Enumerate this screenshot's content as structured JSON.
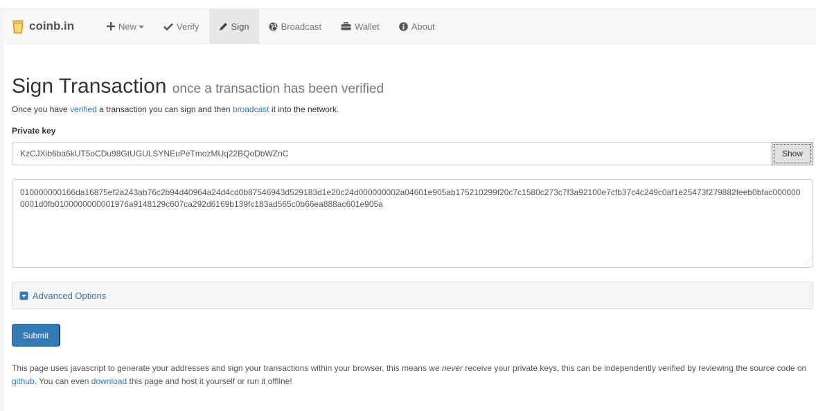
{
  "brand": {
    "name": "coinb.in"
  },
  "nav": {
    "items": [
      {
        "label": "New",
        "icon": "plus-icon",
        "dropdown": true
      },
      {
        "label": "Verify",
        "icon": "check-icon"
      },
      {
        "label": "Sign",
        "icon": "pencil-icon",
        "active": true
      },
      {
        "label": "Broadcast",
        "icon": "globe-icon"
      },
      {
        "label": "Wallet",
        "icon": "briefcase-icon"
      },
      {
        "label": "About",
        "icon": "info-icon"
      }
    ]
  },
  "page": {
    "title": "Sign Transaction",
    "subtitle": "once a transaction has been verified",
    "intro_before": "Once you have ",
    "intro_link1": "verified",
    "intro_middle": " a transaction you can sign and then ",
    "intro_link2": "broadcast",
    "intro_after": " it into the network."
  },
  "form": {
    "private_key_label": "Private key",
    "private_key_value": "KzCJXib6ba6kUT5oCDu98GtUGULSYNEuPeTmozMUq22BQoDbWZnC",
    "show_label": "Show",
    "transaction_hex": "010000000166da16875ef2a243ab76c2b94d40964a24d4cd0b87546943d529183d1e20c24d000000002a04601e905ab175210299f20c7c1580c273c7f3a92100e7cfb37c4c249c0af1e25473f279882feeb0bfac0000000001d0fb0100000000001976a9148129c607ca292d6169b139fc183ad565c0b66ea888ac601e905a",
    "advanced_label": "Advanced Options",
    "submit_label": "Submit"
  },
  "footer": {
    "part1": "This page uses javascript to generate your addresses and sign your transactions within your browser, this means we ",
    "emph": "never",
    "part2": " receive your private keys, this can be independently verified by reviewing the source code on ",
    "link_github": "github",
    "part3": ". You can even ",
    "link_download": "download",
    "part4": " this page and host it yourself or run it offline!"
  },
  "colors": {
    "link": "#337ab7",
    "primary": "#337ab7",
    "navbar": "#f8f8f8"
  }
}
